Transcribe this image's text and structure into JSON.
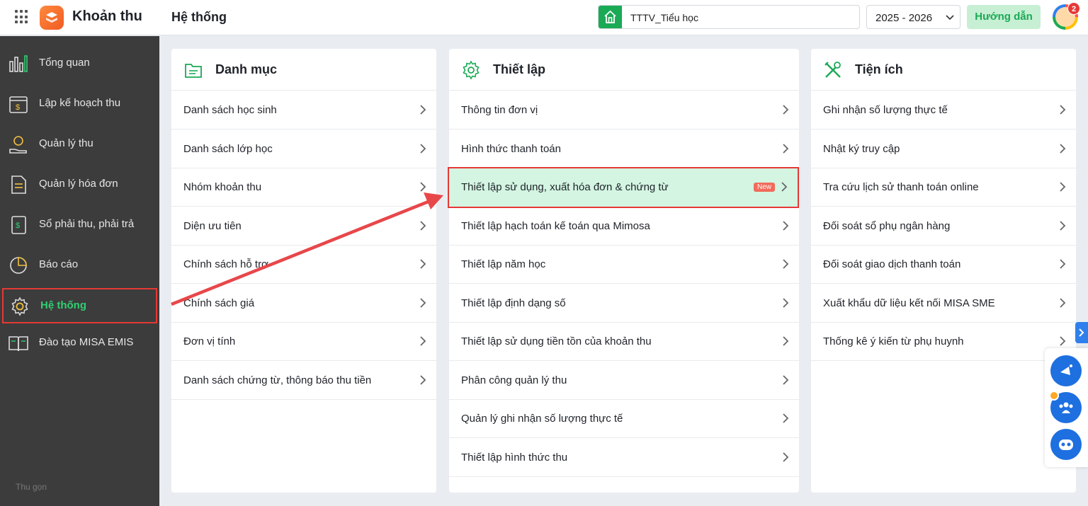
{
  "header": {
    "app_title": "Khoản thu",
    "page_title": "Hệ thống",
    "school": "TTTV_Tiểu học",
    "year": "2025 - 2026",
    "guide_label": "Hướng dẫn",
    "notification_count": "2"
  },
  "sidebar": {
    "items": [
      {
        "label": "Tổng quan",
        "icon": "chart-bars-icon"
      },
      {
        "label": "Lập kế hoạch thu",
        "icon": "calendar-money-icon"
      },
      {
        "label": "Quản lý thu",
        "icon": "hand-coin-icon"
      },
      {
        "label": "Quản lý hóa đơn",
        "icon": "invoice-icon"
      },
      {
        "label": "Sổ phải thu, phải trả",
        "icon": "ledger-book-icon"
      },
      {
        "label": "Báo cáo",
        "icon": "pie-chart-icon"
      },
      {
        "label": "Hệ thống",
        "icon": "gear-icon",
        "active": true
      },
      {
        "label": "Đào tạo MISA EMIS",
        "icon": "open-book-icon"
      }
    ],
    "footer": "Thu gọn"
  },
  "cards": {
    "danh_muc": {
      "title": "Danh mục",
      "items": [
        "Danh sách học sinh",
        "Danh sách lớp học",
        "Nhóm khoản thu",
        "Diện ưu tiên",
        "Chính sách hỗ trợ",
        "Chính sách giá",
        "Đơn vị tính",
        "Danh sách chứng từ, thông báo thu tiền"
      ]
    },
    "thiet_lap": {
      "title": "Thiết lập",
      "items": [
        "Thông tin đơn vị",
        "Hình thức thanh toán",
        "Thiết lập sử dụng, xuất hóa đơn & chứng từ",
        "Thiết lập hạch toán kế toán qua Mimosa",
        "Thiết lập năm học",
        "Thiết lập định dạng số",
        "Thiết lập sử dụng tiền tồn của khoản thu",
        "Phân công quản lý thu",
        "Quản lý ghi nhận số lượng thực tế",
        "Thiết lập hình thức thu"
      ],
      "new_badge": "New"
    },
    "tien_ich": {
      "title": "Tiện ích",
      "items": [
        "Ghi nhận số lượng thực tế",
        "Nhật ký truy cập",
        "Tra cứu lịch sử thanh toán online",
        "Đối soát sổ phụ ngân hàng",
        "Đối soát giao dịch thanh toán",
        "Xuất khẩu dữ liệu kết nối MISA SME",
        "Thống kê ý kiến từ phụ huynh"
      ]
    }
  },
  "colors": {
    "accent": "#1aaa55",
    "highlight_bg": "#d3f5e2",
    "annotation_red": "#e53935",
    "sidebar_bg": "#3c3c3c"
  }
}
